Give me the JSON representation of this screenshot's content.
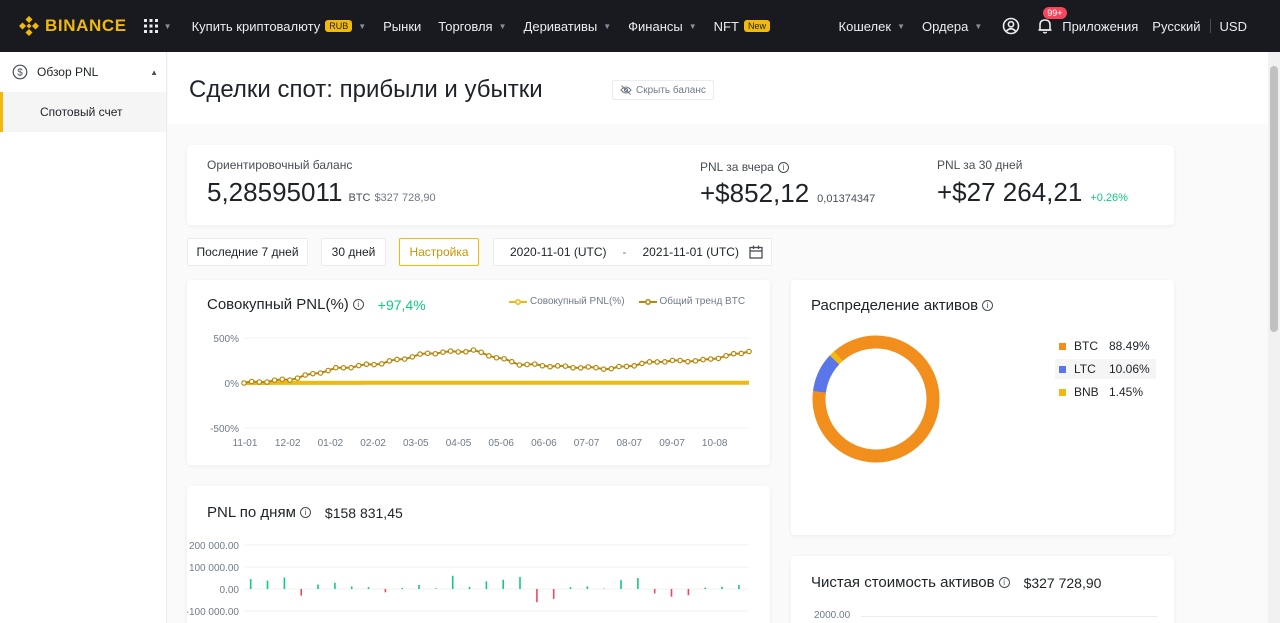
{
  "nav": {
    "logo": "BINANCE",
    "items": [
      {
        "label": "Купить криптовалюту",
        "badge": "RUB",
        "caret": true
      },
      {
        "label": "Рынки",
        "caret": false
      },
      {
        "label": "Торговля",
        "caret": true
      },
      {
        "label": "Деривативы",
        "caret": true
      },
      {
        "label": "Финансы",
        "caret": true
      },
      {
        "label": "NFT",
        "badge": "New",
        "caret": false
      }
    ],
    "wallet": "Кошелек",
    "orders": "Ордера",
    "notifications": "99+",
    "apps": "Приложения",
    "language": "Русский",
    "currency": "USD"
  },
  "sidebar": {
    "header": "Обзор PNL",
    "item": "Спотовый счет"
  },
  "page": {
    "title": "Сделки спот: прибыли и убытки",
    "hide_balance": "Скрыть баланс"
  },
  "summary": {
    "balance_label": "Ориентировочный баланс",
    "balance_value": "5,28595011",
    "balance_unit": "BTC",
    "balance_usd": "$327 728,90",
    "pnl_yesterday_label": "PNL за вчера",
    "pnl_yesterday_value": "+$852,12",
    "pnl_yesterday_btc": "0,01374347",
    "pnl_30_label": "PNL за 30 дней",
    "pnl_30_value": "+$27 264,21",
    "pnl_30_pct": "+0.26%"
  },
  "filters": {
    "last7": "Последние 7 дней",
    "days30": "30 дней",
    "custom": "Настройка",
    "date_from": "2020-11-01 (UTC)",
    "separator": "-",
    "date_to": "2021-11-01 (UTC)"
  },
  "pnl_card": {
    "title": "Совокупный PNL(%)",
    "value": "+97,4%",
    "legend": [
      "Совокупный PNL(%)",
      "Общий тренд BTC"
    ]
  },
  "daily_card": {
    "title": "PNL по дням",
    "value": "$158 831,45"
  },
  "dist_card": {
    "title": "Распределение активов",
    "assets": [
      {
        "name": "BTC",
        "pct": "88.49%",
        "value": 88.49,
        "color": "#f28e1c"
      },
      {
        "name": "LTC",
        "pct": "10.06%",
        "value": 10.06,
        "color": "#5a76e8"
      },
      {
        "name": "BNB",
        "pct": "1.45%",
        "value": 1.45,
        "color": "#f0b90b"
      }
    ]
  },
  "net_card": {
    "title": "Чистая стоимость активов",
    "value": "$327 728,90",
    "first_tick": "2000.00"
  },
  "chart_data": [
    {
      "type": "line",
      "title": "Совокупный PNL(%)",
      "categories": [
        "11-01",
        "12-02",
        "01-02",
        "02-02",
        "03-05",
        "04-05",
        "05-06",
        "06-06",
        "07-07",
        "08-07",
        "09-07",
        "10-08"
      ],
      "yticks": [
        "500%",
        "0%",
        "-500%"
      ],
      "ylim": [
        -500,
        500
      ],
      "series": [
        {
          "name": "Совокупный PNL(%)",
          "color": "#f0b90b",
          "values": [
            0,
            1,
            1,
            2,
            2,
            2,
            2,
            2,
            2,
            2,
            2,
            2
          ]
        },
        {
          "name": "Общий тренд BTC",
          "color": "#b8860b",
          "values": [
            0,
            40,
            160,
            220,
            330,
            360,
            210,
            180,
            160,
            240,
            250,
            350
          ]
        }
      ]
    },
    {
      "type": "bar",
      "title": "PNL по дням",
      "yticks": [
        "200 000.00",
        "100 000.00",
        "0.00",
        "-100 000.00"
      ],
      "ylim": [
        -100000,
        200000
      ],
      "values": [
        45000,
        38000,
        52000,
        -30000,
        20000,
        28000,
        12000,
        8000,
        -15000,
        5000,
        18000,
        3000,
        60000,
        10000,
        35000,
        42000,
        55000,
        -60000,
        -45000,
        8000,
        12000,
        2000,
        40000,
        50000,
        -20000,
        -35000,
        -28000,
        6000,
        10000,
        18000
      ]
    },
    {
      "type": "pie",
      "title": "Распределение активов",
      "categories": [
        "BTC",
        "LTC",
        "BNB"
      ],
      "values": [
        88.49,
        10.06,
        1.45
      ]
    }
  ]
}
